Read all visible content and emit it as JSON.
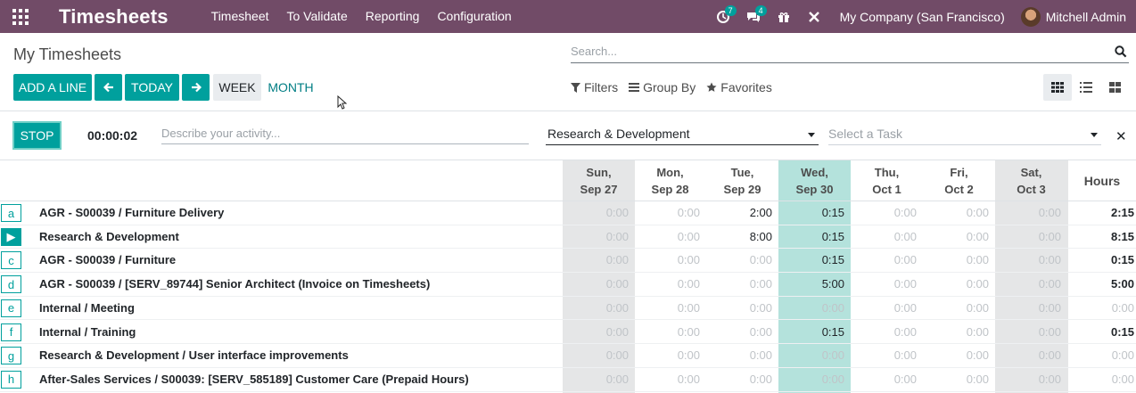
{
  "navbar": {
    "brand": "Timesheets",
    "menu": [
      "Timesheet",
      "To Validate",
      "Reporting",
      "Configuration"
    ],
    "activity_badge": "7",
    "messages_badge": "4",
    "company": "My Company (San Francisco)",
    "user": "Mitchell Admin",
    "color": "#714b67"
  },
  "control_panel": {
    "title": "My Timesheets",
    "search_placeholder": "Search...",
    "add_line": "ADD A LINE",
    "today": "TODAY",
    "week": "WEEK",
    "month": "MONTH",
    "filters": "Filters",
    "group_by": "Group By",
    "favorites": "Favorites"
  },
  "timer": {
    "stop_label": "STOP",
    "elapsed": "00:00:02",
    "description_placeholder": "Describe your activity...",
    "project": "Research & Development",
    "task_placeholder": "Select a Task"
  },
  "grid": {
    "days": [
      {
        "day": "Sun,",
        "date": "Sep 27",
        "kind": "weekend"
      },
      {
        "day": "Mon,",
        "date": "Sep 28",
        "kind": "normal"
      },
      {
        "day": "Tue,",
        "date": "Sep 29",
        "kind": "normal"
      },
      {
        "day": "Wed,",
        "date": "Sep 30",
        "kind": "today"
      },
      {
        "day": "Thu,",
        "date": "Oct 1",
        "kind": "normal"
      },
      {
        "day": "Fri,",
        "date": "Oct 2",
        "kind": "normal"
      },
      {
        "day": "Sat,",
        "date": "Oct 3",
        "kind": "weekend"
      }
    ],
    "total_header": "Hours",
    "rows": [
      {
        "key": "a",
        "label": "AGR - S00039  /  Furniture Delivery",
        "values": [
          "0:00",
          "0:00",
          "2:00",
          "0:15",
          "0:00",
          "0:00",
          "0:00"
        ],
        "total": "2:15"
      },
      {
        "key": "▶",
        "label": "Research & Development",
        "values": [
          "0:00",
          "0:00",
          "8:00",
          "0:15",
          "0:00",
          "0:00",
          "0:00"
        ],
        "total": "8:15"
      },
      {
        "key": "c",
        "label": "AGR - S00039  /  Furniture",
        "values": [
          "0:00",
          "0:00",
          "0:00",
          "0:15",
          "0:00",
          "0:00",
          "0:00"
        ],
        "total": "0:15"
      },
      {
        "key": "d",
        "label": "AGR - S00039 / [SERV_89744] Senior Architect (Invoice on Timesheets)",
        "values": [
          "0:00",
          "0:00",
          "0:00",
          "5:00",
          "0:00",
          "0:00",
          "0:00"
        ],
        "total": "5:00"
      },
      {
        "key": "e",
        "label": "Internal  /  Meeting",
        "values": [
          "0:00",
          "0:00",
          "0:00",
          "0:00",
          "0:00",
          "0:00",
          "0:00"
        ],
        "total": "0:00"
      },
      {
        "key": "f",
        "label": "Internal  /  Training",
        "values": [
          "0:00",
          "0:00",
          "0:00",
          "0:15",
          "0:00",
          "0:00",
          "0:00"
        ],
        "total": "0:15"
      },
      {
        "key": "g",
        "label": "Research & Development  /  User interface improvements",
        "values": [
          "0:00",
          "0:00",
          "0:00",
          "0:00",
          "0:00",
          "0:00",
          "0:00"
        ],
        "total": "0:00"
      },
      {
        "key": "h",
        "label": "After-Sales Services / S00039: [SERV_585189] Customer Care (Prepaid Hours)",
        "values": [
          "0:00",
          "0:00",
          "0:00",
          "0:00",
          "0:00",
          "0:00",
          "0:00"
        ],
        "total": "0:00"
      }
    ]
  }
}
